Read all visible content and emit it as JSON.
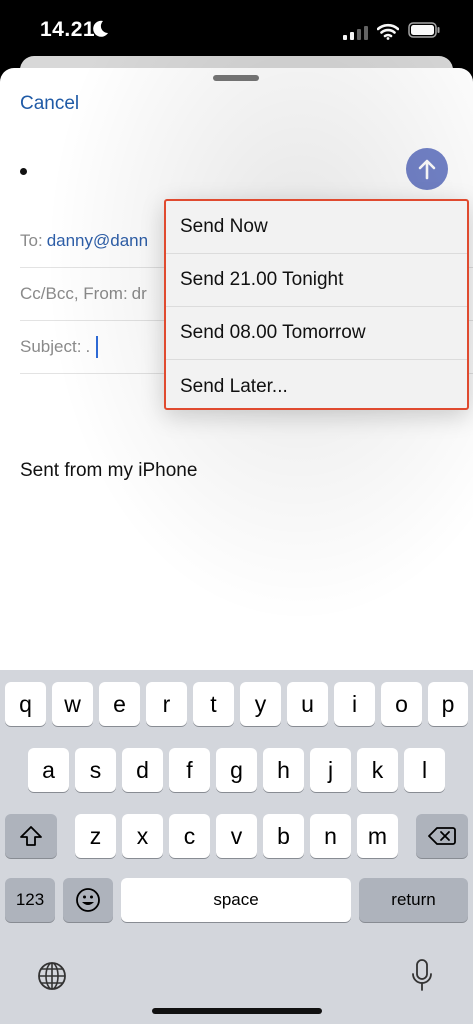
{
  "status": {
    "time": "14.21"
  },
  "compose": {
    "cancel_label": "Cancel",
    "to_label": "To:",
    "to_value": "danny@dann",
    "ccbcc_label": "Cc/Bcc, From:",
    "ccbcc_value": "dr",
    "subject_label": "Subject:",
    "subject_value": ".",
    "signature": "Sent from my iPhone"
  },
  "send_menu": {
    "items": [
      "Send Now",
      "Send 21.00 Tonight",
      "Send 08.00 Tomorrow",
      "Send Later..."
    ]
  },
  "keyboard": {
    "row1": [
      "q",
      "w",
      "e",
      "r",
      "t",
      "y",
      "u",
      "i",
      "o",
      "p"
    ],
    "row2": [
      "a",
      "s",
      "d",
      "f",
      "g",
      "h",
      "j",
      "k",
      "l"
    ],
    "row3": [
      "z",
      "x",
      "c",
      "v",
      "b",
      "n",
      "m"
    ],
    "numbers_label": "123",
    "space_label": "space",
    "return_label": "return"
  },
  "colors": {
    "accent": "#1f5aa6",
    "send_button": "#7383c9",
    "highlight_border": "#e04a2f"
  },
  "icons": [
    "moon-icon",
    "signal-icon",
    "wifi-icon",
    "battery-icon",
    "send-arrow-icon",
    "shift-icon",
    "backspace-icon",
    "emoji-icon",
    "globe-icon",
    "microphone-icon"
  ]
}
